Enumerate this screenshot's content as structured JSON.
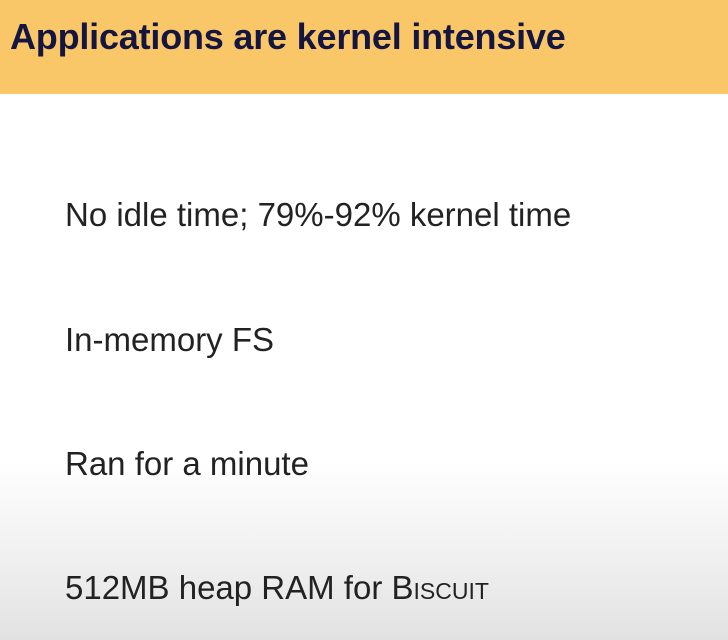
{
  "slide": {
    "title": "Applications are kernel intensive",
    "bullets": [
      "No idle time; 79%-92% kernel time",
      "In-memory FS",
      "Ran for a minute"
    ],
    "bullet4_prefix": "512MB heap RAM for ",
    "bullet4_name": "Biscuit",
    "colors": {
      "header_background": "#f9c768",
      "title_text": "#141540",
      "body_text": "#222222"
    }
  }
}
